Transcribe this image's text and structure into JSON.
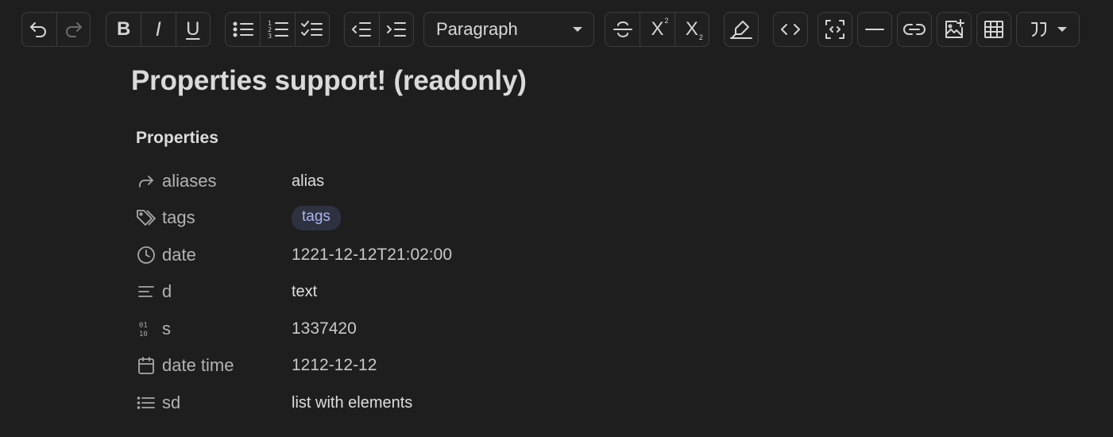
{
  "toolbar": {
    "undo_icon": "undo-icon",
    "redo_icon": "redo-icon",
    "bold": "B",
    "italic": "I",
    "underline": "U",
    "paragraph_select": {
      "selected": "Paragraph"
    },
    "superscript": {
      "base": "X",
      "mark": "2"
    },
    "subscript": {
      "base": "X",
      "mark": "2"
    }
  },
  "document": {
    "title": "Properties support! (readonly)",
    "properties_heading": "Properties",
    "properties": [
      {
        "key": "aliases",
        "value": "alias",
        "icon": "forward-arrow-icon"
      },
      {
        "key": "tags",
        "value": "tags",
        "icon": "tags-icon"
      },
      {
        "key": "date",
        "value": "1221-12-12T21:02:00",
        "icon": "clock-icon"
      },
      {
        "key": "d",
        "value": "text",
        "icon": "text-lines-icon"
      },
      {
        "key": "s",
        "value": "1337420",
        "icon": "binary-number-icon"
      },
      {
        "key": "date time",
        "value": "1212-12-12",
        "icon": "calendar-icon"
      },
      {
        "key": "sd",
        "value": "list with elements",
        "icon": "list-icon"
      }
    ]
  },
  "colors": {
    "background": "#1e1e1e",
    "tag_background": "#2e3140",
    "tag_text": "#a9b6ec"
  }
}
